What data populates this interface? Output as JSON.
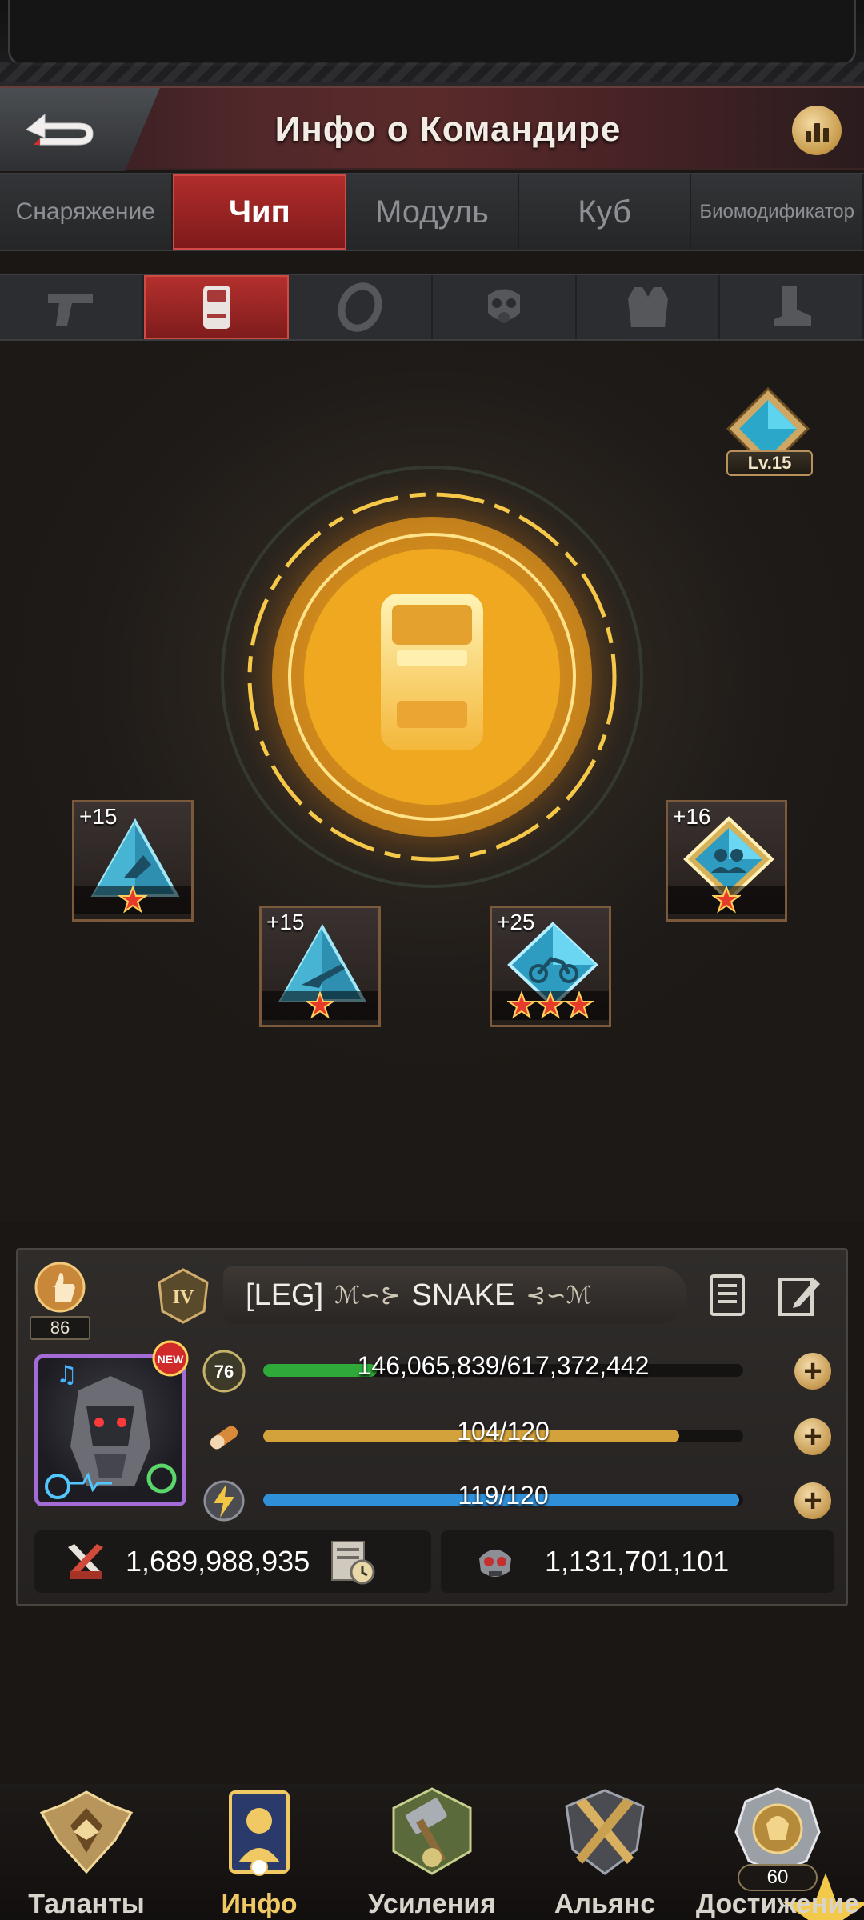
{
  "header": {
    "title": "Инфо о Командире"
  },
  "tabs": [
    {
      "label": "Снаряжение",
      "active": false
    },
    {
      "label": "Чип",
      "active": true
    },
    {
      "label": "Модуль",
      "active": false
    },
    {
      "label": "Куб",
      "active": false
    },
    {
      "label": "Биомодификатор",
      "active": false
    }
  ],
  "slots": [
    {
      "icon": "pistol-icon",
      "active": false
    },
    {
      "icon": "chip-slot-icon",
      "active": true
    },
    {
      "icon": "ring-icon",
      "active": false
    },
    {
      "icon": "gas-mask-icon",
      "active": false
    },
    {
      "icon": "armor-vest-icon",
      "active": false
    },
    {
      "icon": "boot-icon",
      "active": false
    }
  ],
  "chip_level": {
    "label": "Lv.15"
  },
  "chips": [
    {
      "level": "+15",
      "stars": 1,
      "icon": "blue-triangle-chip-icon"
    },
    {
      "level": "+15",
      "stars": 1,
      "icon": "blue-triangle-rifle-chip-icon"
    },
    {
      "level": "+25",
      "stars": 3,
      "icon": "blue-diamond-motorbike-chip-icon"
    },
    {
      "level": "+16",
      "stars": 1,
      "icon": "gold-diamond-squad-chip-icon"
    }
  ],
  "commander": {
    "power_level": "86",
    "rank": "IV",
    "name_prefix": "[LEG]",
    "name": "SNAKE",
    "avatar_level": "76",
    "new_badge": "NEW",
    "stats": [
      {
        "icon": "level-icon",
        "value": "146,065,839/617,372,442",
        "progress": 0.237,
        "color": "#2fa93a"
      },
      {
        "icon": "stamina-icon",
        "value": "104/120",
        "progress": 0.867,
        "color": "#d4a23a"
      },
      {
        "icon": "energy-icon",
        "value": "119/120",
        "progress": 0.992,
        "color": "#2f8fd8"
      }
    ],
    "power_total": "1,689,988,935",
    "kills_total": "1,131,701,101"
  },
  "nav": [
    {
      "label": "Таланты",
      "icon": "talents-icon",
      "active": false
    },
    {
      "label": "Инфо",
      "icon": "info-icon",
      "active": true
    },
    {
      "label": "Усиления",
      "icon": "boosts-icon",
      "active": false
    },
    {
      "label": "Альянс",
      "icon": "alliance-icon",
      "active": false
    },
    {
      "label": "Достижение",
      "icon": "achievement-icon",
      "active": false
    }
  ],
  "achievement_points": "60"
}
